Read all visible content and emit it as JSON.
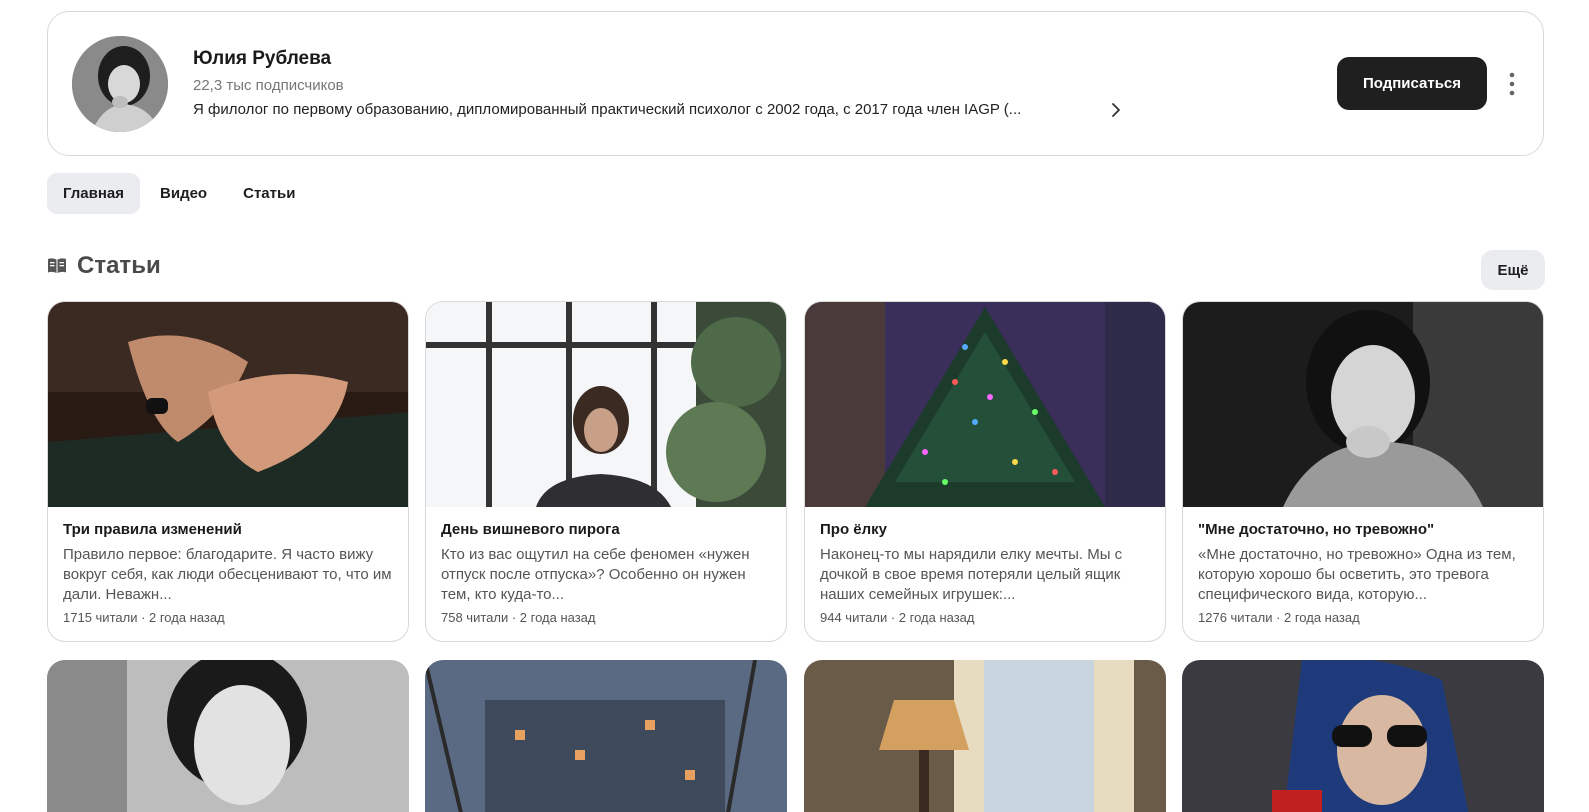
{
  "channel": {
    "name": "Юлия Рублева",
    "subscribers": "22,3 тыс подписчиков",
    "description": "Я филолог по первому образованию, дипломированный практический психолог с 2002 года, с 2017 года член IAGP (...",
    "subscribe_label": "Подписаться"
  },
  "tabs": [
    {
      "label": "Главная",
      "active": true
    },
    {
      "label": "Видео",
      "active": false
    },
    {
      "label": "Статьи",
      "active": false
    }
  ],
  "section": {
    "title": "Статьи",
    "more_label": "Ещё"
  },
  "articles": [
    {
      "title": "Три правила изменений",
      "snippet": "Правило первое: благодарите. Я часто вижу вокруг себя, как люди обесценивают то, что им дали. Неважн...",
      "meta": "1715 читали · 2 года назад"
    },
    {
      "title": "День вишневого пирога",
      "snippet": "Кто из вас ощутил на себе феномен «нужен отпуск после отпуска»? Особенно он нужен тем, кто куда-то...",
      "meta": "758 читали · 2 года назад"
    },
    {
      "title": "Про ёлку",
      "snippet": "Наконец-то мы нарядили елку мечты. Мы с дочкой в свое время потеряли целый ящик наших семейных игрушек:...",
      "meta": "944 читали · 2 года назад"
    },
    {
      "title": "\"Мне достаточно, но тревожно\"",
      "snippet": "«Мне достаточно, но тревожно» Одна из тем, которую хорошо бы осветить, это тревога специфического вида, которую...",
      "meta": "1276 читали · 2 года назад"
    }
  ],
  "icons": {
    "chevron": "chevron-right-icon",
    "more": "more-vertical-icon",
    "section": "article-book-icon"
  },
  "colors": {
    "button_dark": "#1f1f1f",
    "tab_active_bg": "#ebecef",
    "border": "#d9d9d9"
  }
}
